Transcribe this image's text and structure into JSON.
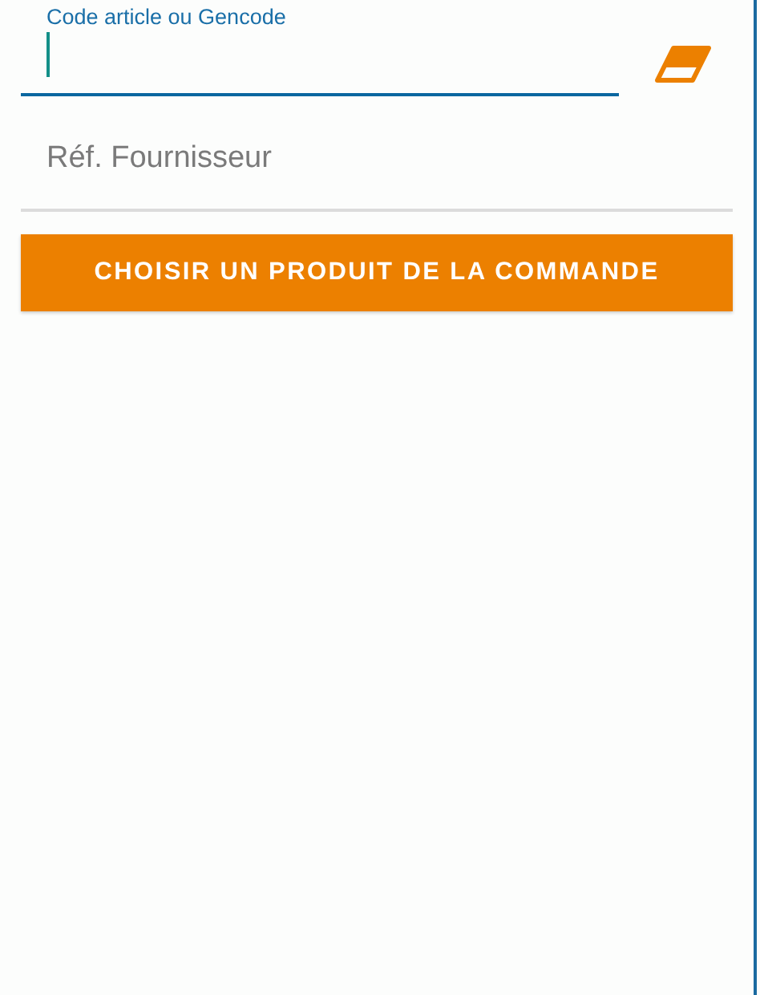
{
  "code_field": {
    "label": "Code article ou Gencode",
    "focused": true
  },
  "supplier_field": {
    "placeholder": "Réf. Fournisseur"
  },
  "choose_button": {
    "label": "CHOISIR UN PRODUIT DE LA COMMANDE"
  }
}
